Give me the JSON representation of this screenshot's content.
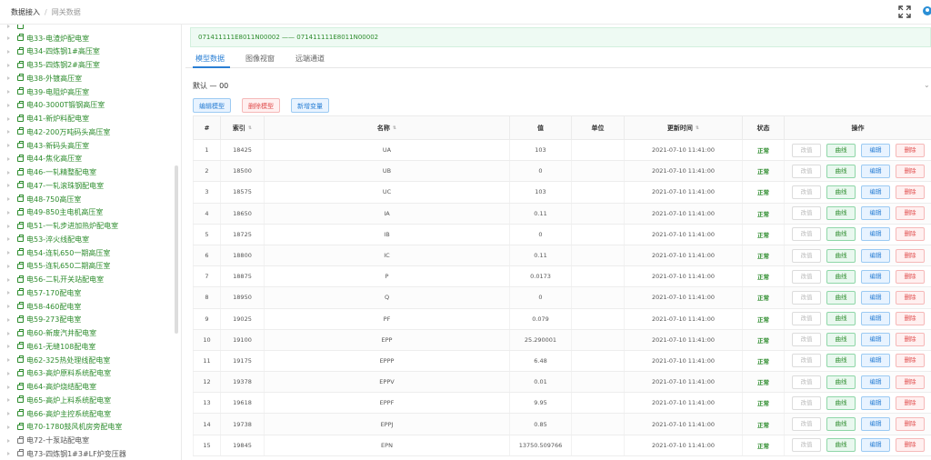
{
  "breadcrumb": {
    "root": "数据接入",
    "sep": "/",
    "current": "网关数据"
  },
  "colors": {
    "accent": "#2a7fd4",
    "green": "#2d8c2d",
    "danger": "#e04b4b"
  },
  "sidebar": {
    "items": [
      {
        "label": "电33-电渣炉配电室"
      },
      {
        "label": "电34-四炼钢1#高压室"
      },
      {
        "label": "电35-四炼钢2#高压室"
      },
      {
        "label": "电38-外镀高压室"
      },
      {
        "label": "电39-电阻炉高压室"
      },
      {
        "label": "电40-3000T锻钢高压室"
      },
      {
        "label": "电41-新炉料配电室"
      },
      {
        "label": "电42-200万吨码头高压室"
      },
      {
        "label": "电43-新码头高压室"
      },
      {
        "label": "电44-焦化高压室"
      },
      {
        "label": "电46-一轧精整配电室"
      },
      {
        "label": "电47-一轧滚珠钢配电室"
      },
      {
        "label": "电48-750高压室"
      },
      {
        "label": "电49-850主电机高压室"
      },
      {
        "label": "电51-一轧步进加热炉配电室"
      },
      {
        "label": "电53-淬火线配电室"
      },
      {
        "label": "电54-连轧650一期高压室"
      },
      {
        "label": "电55-连轧650二期高压室"
      },
      {
        "label": "电56-二轧开关站配电室"
      },
      {
        "label": "电57-170配电室"
      },
      {
        "label": "电58-460配电室"
      },
      {
        "label": "电59-273配电室"
      },
      {
        "label": "电60-新废汽井配电室"
      },
      {
        "label": "电61-无缝108配电室"
      },
      {
        "label": "电62-325热处理线配电室"
      },
      {
        "label": "电63-高炉原料系统配电室"
      },
      {
        "label": "电64-高炉烧结配电室"
      },
      {
        "label": "电65-高炉上料系统配电室"
      },
      {
        "label": "电66-高炉主控系统配电室"
      },
      {
        "label": "电70-1780鼓风机房旁配电室"
      },
      {
        "label": "电72-十泵站配电室"
      },
      {
        "label": "电73-四炼钢1#3#LF炉变压器"
      }
    ]
  },
  "main": {
    "banner": "071411111E8011N00002 —— 071411111E8011N00002",
    "tabs": [
      {
        "label": "模型数据"
      },
      {
        "label": "图像视窗"
      },
      {
        "label": "远端通道"
      }
    ],
    "group_label": "默认 — 00",
    "toolbar": {
      "edit_model": "编辑模型",
      "delete_model": "删除模型",
      "add_var": "新增变量"
    },
    "table": {
      "headers": {
        "idx": "#",
        "index": "索引",
        "name": "名称",
        "value": "值",
        "unit": "单位",
        "updated": "更新时间",
        "status": "状态",
        "ops": "操作"
      },
      "op_labels": {
        "alter": "改值",
        "curve": "曲线",
        "edit": "编辑",
        "delete": "删除"
      },
      "rows": [
        {
          "n": "1",
          "index": "18425",
          "name": "UA",
          "value": "103",
          "unit": "",
          "time": "2021-07-10 11:41:00",
          "status": "正常"
        },
        {
          "n": "2",
          "index": "18500",
          "name": "UB",
          "value": "0",
          "unit": "",
          "time": "2021-07-10 11:41:00",
          "status": "正常"
        },
        {
          "n": "3",
          "index": "18575",
          "name": "UC",
          "value": "103",
          "unit": "",
          "time": "2021-07-10 11:41:00",
          "status": "正常"
        },
        {
          "n": "4",
          "index": "18650",
          "name": "IA",
          "value": "0.11",
          "unit": "",
          "time": "2021-07-10 11:41:00",
          "status": "正常"
        },
        {
          "n": "5",
          "index": "18725",
          "name": "IB",
          "value": "0",
          "unit": "",
          "time": "2021-07-10 11:41:00",
          "status": "正常"
        },
        {
          "n": "6",
          "index": "18800",
          "name": "IC",
          "value": "0.11",
          "unit": "",
          "time": "2021-07-10 11:41:00",
          "status": "正常"
        },
        {
          "n": "7",
          "index": "18875",
          "name": "P",
          "value": "0.0173",
          "unit": "",
          "time": "2021-07-10 11:41:00",
          "status": "正常"
        },
        {
          "n": "8",
          "index": "18950",
          "name": "Q",
          "value": "0",
          "unit": "",
          "time": "2021-07-10 11:41:00",
          "status": "正常"
        },
        {
          "n": "9",
          "index": "19025",
          "name": "PF",
          "value": "0.079",
          "unit": "",
          "time": "2021-07-10 11:41:00",
          "status": "正常"
        },
        {
          "n": "10",
          "index": "19100",
          "name": "EPP",
          "value": "25.290001",
          "unit": "",
          "time": "2021-07-10 11:41:00",
          "status": "正常"
        },
        {
          "n": "11",
          "index": "19175",
          "name": "EPPP",
          "value": "6.48",
          "unit": "",
          "time": "2021-07-10 11:41:00",
          "status": "正常"
        },
        {
          "n": "12",
          "index": "19378",
          "name": "EPPV",
          "value": "0.01",
          "unit": "",
          "time": "2021-07-10 11:41:00",
          "status": "正常"
        },
        {
          "n": "13",
          "index": "19618",
          "name": "EPPF",
          "value": "9.95",
          "unit": "",
          "time": "2021-07-10 11:41:00",
          "status": "正常"
        },
        {
          "n": "14",
          "index": "19738",
          "name": "EPPJ",
          "value": "0.85",
          "unit": "",
          "time": "2021-07-10 11:41:00",
          "status": "正常"
        },
        {
          "n": "15",
          "index": "19845",
          "name": "EPN",
          "value": "13750.509766",
          "unit": "",
          "time": "2021-07-10 11:41:00",
          "status": "正常"
        }
      ]
    }
  }
}
